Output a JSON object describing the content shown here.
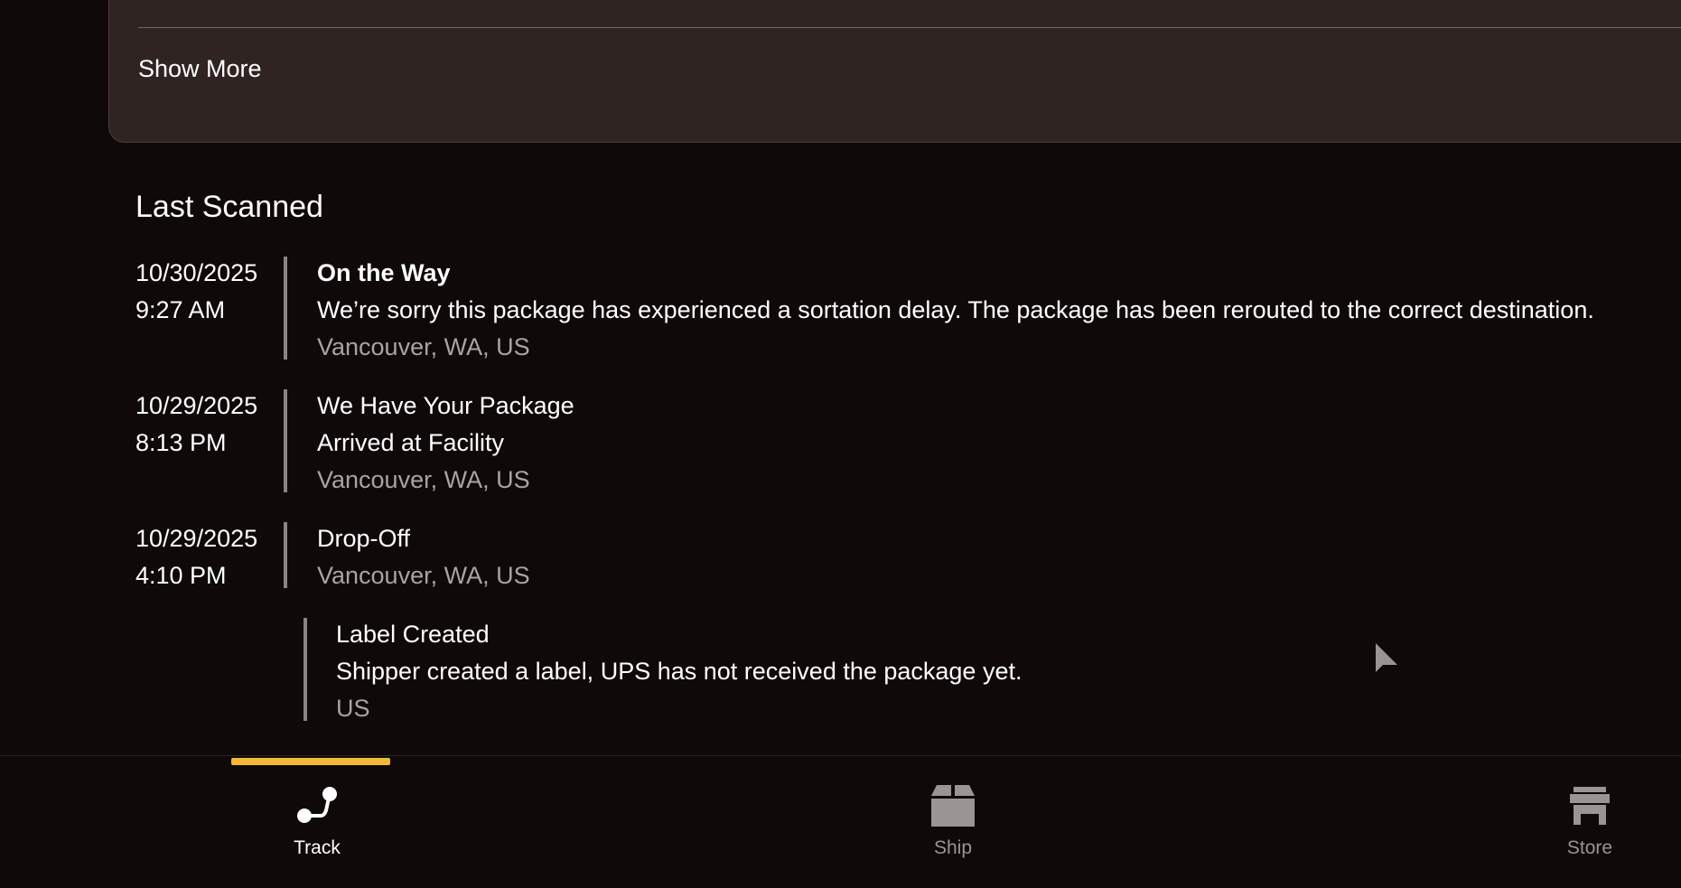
{
  "card": {
    "show_more_label": "Show More"
  },
  "last_scanned": {
    "title": "Last Scanned",
    "events": [
      {
        "date": "10/30/2025",
        "time": "9:27 AM",
        "title": "On the Way",
        "description": "We’re sorry this package has experienced a sortation delay. The package has been rerouted to the correct destination.",
        "location": "Vancouver, WA, US"
      },
      {
        "date": "10/29/2025",
        "time": "8:13 PM",
        "title": "We Have Your Package",
        "description": "Arrived at Facility",
        "location": "Vancouver, WA, US"
      },
      {
        "date": "10/29/2025",
        "time": "4:10 PM",
        "title": "Drop-Off",
        "location": "Vancouver, WA, US"
      },
      {
        "title": "Label Created",
        "description": "Shipper created a label, UPS has not received the package yet.",
        "location": "US"
      }
    ]
  },
  "bottom_nav": {
    "items": [
      {
        "label": "Track",
        "icon": "track-route-icon",
        "active": true
      },
      {
        "label": "Ship",
        "icon": "box-icon",
        "active": false
      },
      {
        "label": "Store",
        "icon": "store-icon",
        "active": false
      }
    ],
    "accent_color": "#f2b935"
  },
  "colors": {
    "background": "#0f0a09",
    "card": "#302422",
    "muted_text": "#a9a3a1",
    "timeline_bar": "#8c8482"
  }
}
